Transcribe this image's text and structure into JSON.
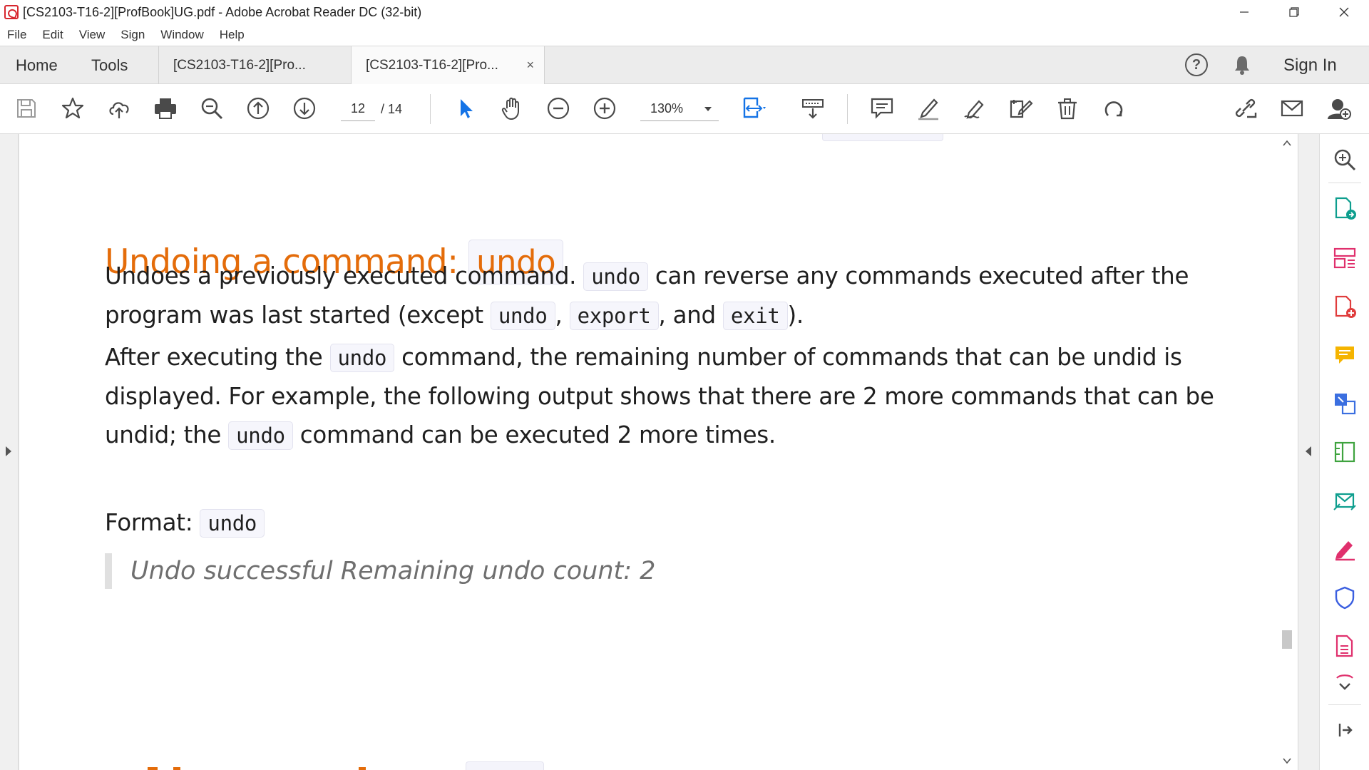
{
  "window": {
    "title": "[CS2103-T16-2][ProfBook]UG.pdf - Adobe Acrobat Reader DC (32-bit)",
    "minimize": "—",
    "restore": "❐",
    "close": "✕"
  },
  "menu": [
    "File",
    "Edit",
    "View",
    "Sign",
    "Window",
    "Help"
  ],
  "tabs": {
    "home": "Home",
    "tools": "Tools",
    "doc_tab_1": "[CS2103-T16-2][Pro...",
    "doc_tab_2": "[CS2103-T16-2][Pro...",
    "close_glyph": "×",
    "help": "?",
    "sign_in": "Sign In"
  },
  "toolbar": {
    "current_page": "12",
    "total_pages": "/ 14",
    "zoom": "130%"
  },
  "document": {
    "heading_text": "Undoing a command: ",
    "heading_code": "undo",
    "p1": {
      "t1": "Undoes a previously executed command. ",
      "c1": "undo",
      "t2": " can reverse any commands executed after the program was last started (except ",
      "c2": "undo",
      "t3": ", ",
      "c3": "export",
      "t4": ", and ",
      "c4": "exit",
      "t5": ")."
    },
    "p2": {
      "t1": "After executing the ",
      "c1": "undo",
      "t2": " command, the remaining number of commands that can be undid is displayed. For example, the following output shows that there are 2 more commands that can be undid; the ",
      "c2": "undo",
      "t3": " command can be executed 2 more times."
    },
    "quote": "Undo successful Remaining undo count: 2",
    "format_label": "Format: ",
    "format_code": "undo"
  },
  "icons": {
    "toolbar": [
      "save-icon",
      "bookmark-star-icon",
      "cloud-upload-icon",
      "print-icon",
      "zoom-search-icon",
      "prev-page-icon",
      "next-page-icon",
      "select-cursor-icon",
      "hand-icon",
      "zoom-out-icon",
      "zoom-in-icon",
      "fit-page-icon",
      "scroll-mode-icon",
      "comment-icon",
      "highlight-icon",
      "draw-icon",
      "fill-sign-icon",
      "delete-icon",
      "rotate-icon",
      "share-link-icon",
      "email-icon",
      "add-user-icon"
    ],
    "tools_pane": [
      "search-zoom-icon",
      "export-pdf-icon",
      "organize-pages-icon",
      "create-pdf-icon",
      "comment-icon",
      "edit-pdf-icon",
      "compress-icon",
      "send-review-icon",
      "fill-sign-icon",
      "protect-icon",
      "save-pdf-icon",
      "more-tools-icon",
      "collapse-pane-icon"
    ]
  },
  "colors": {
    "heading": "#e46c0a",
    "acrobat_red": "#d7262e",
    "select_blue": "#1473e6"
  }
}
